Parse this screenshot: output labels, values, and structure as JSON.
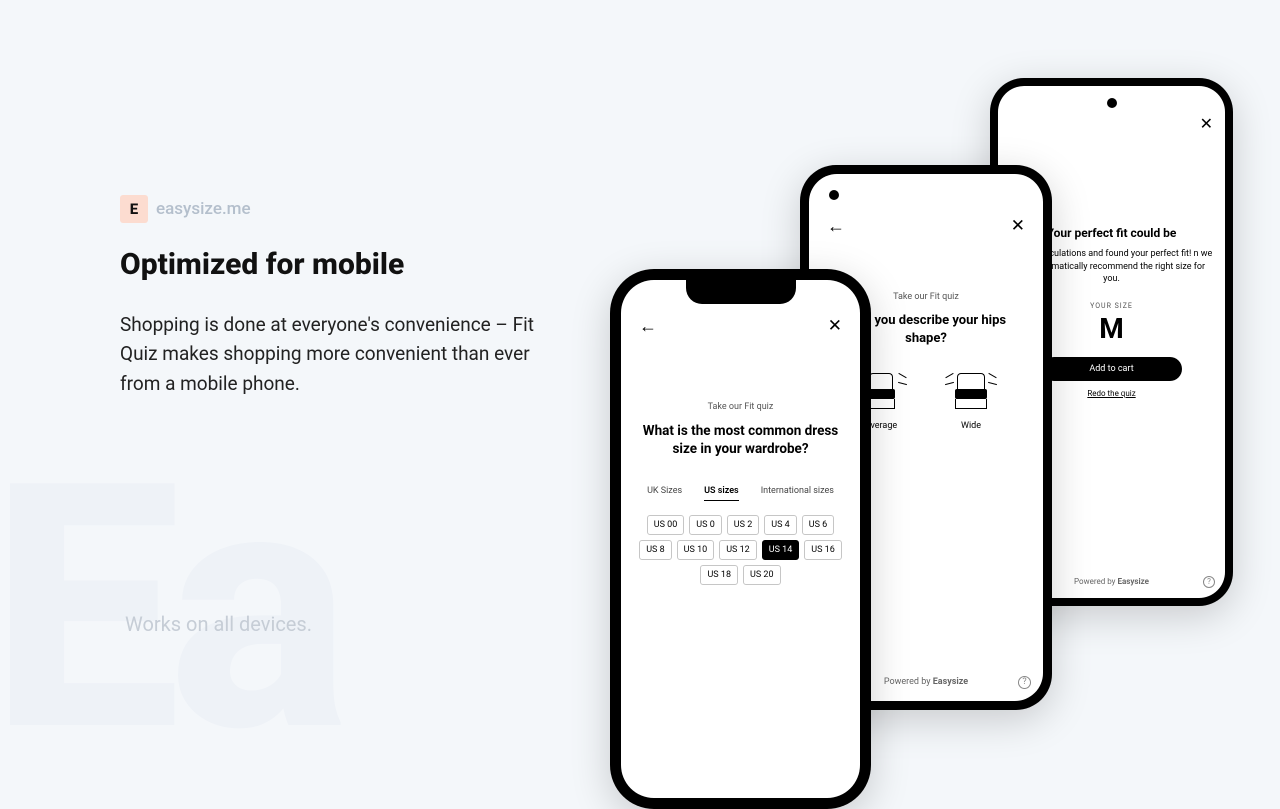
{
  "brand": {
    "badge": "E",
    "name": "easysize.me"
  },
  "headline": "Optimized for mobile",
  "body": "Shopping is done at everyone's convenience – Fit Quiz makes shopping more convenient than ever from a mobile phone.",
  "footnote": "Works on all devices.",
  "phone1": {
    "kicker": "Take our Fit quiz",
    "question": "What is the most common dress size in your wardrobe?",
    "tabs": {
      "uk": "UK Sizes",
      "us": "US sizes",
      "intl": "International sizes"
    },
    "sizes": [
      "US 00",
      "US 0",
      "US 2",
      "US 4",
      "US 6",
      "US 8",
      "US 10",
      "US 12",
      "US 14",
      "US 16",
      "US 18",
      "US 20"
    ],
    "selected": "US 14"
  },
  "phone2": {
    "kicker": "Take our Fit quiz",
    "question_visible": "ould you describe your hips shape?",
    "options": {
      "average": "Average",
      "wide": "Wide"
    },
    "powered_prefix": "Powered by ",
    "powered_brand": "Easysize"
  },
  "phone3": {
    "title": "Your perfect fit could be",
    "desc": "he the calculations and found your perfect fit! n we will automatically recommend the right size for you.",
    "label": "YOUR SIZE",
    "size": "M",
    "add": "Add to cart",
    "redo": "Redo the quiz",
    "powered_prefix": "Powered by ",
    "powered_brand": "Easysize"
  }
}
